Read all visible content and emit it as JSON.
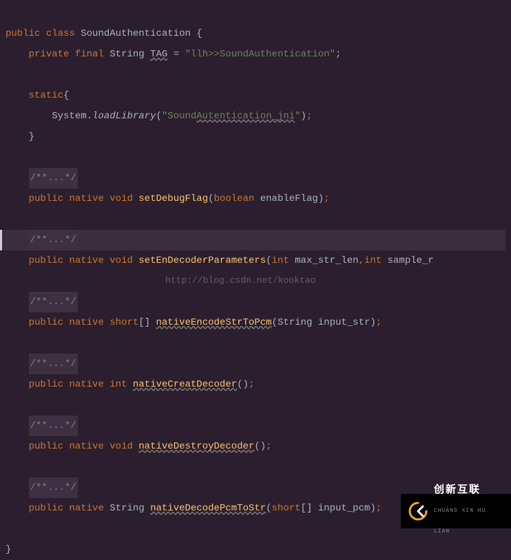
{
  "code": {
    "l1": {
      "kw1": "public",
      "kw2": "class",
      "cls": "SoundAuthentication",
      "brace": "{"
    },
    "l2": {
      "kw1": "private",
      "kw2": "final",
      "type": "String",
      "var": "TAG",
      "eq": "=",
      "str": "\"llh>>SoundAuthentication\"",
      "semi": ";"
    },
    "l3": {
      "kw": "static",
      "brace": "{"
    },
    "l4": {
      "cls": "System.",
      "method": "loadLibrary",
      "open": "(",
      "str": "\"Sound",
      "str2": "Autentication_jni",
      "str3": "\"",
      "close": ")",
      "semi": ";"
    },
    "l5": {
      "brace": "}"
    },
    "fold": "/**...*/",
    "l6": {
      "kw1": "public",
      "kw2": "native",
      "kw3": "void",
      "method": "setDebugFlag",
      "open": "(",
      "ptype": "boolean",
      "pname": "enableFlag",
      "close": ")",
      "semi": ";"
    },
    "l7": {
      "kw1": "public",
      "kw2": "native",
      "kw3": "void",
      "method": "setEnDecoderParameters",
      "open": "(",
      "ptype1": "int",
      "pname1": "max_str_len",
      "comma": ",",
      "ptype2": "int",
      "pname2": "sample_r"
    },
    "l8": {
      "kw1": "public",
      "kw2": "native",
      "kw3": "short",
      "arr": "[]",
      "method": "nativeEncodeStrToPcm",
      "open": "(",
      "ptype": "String",
      "pname": "input_str",
      "close": ")",
      "semi": ";"
    },
    "l9": {
      "kw1": "public",
      "kw2": "native",
      "kw3": "int",
      "method": "nativeCreatDecoder",
      "open": "(",
      "close": ")",
      "semi": ";"
    },
    "l10": {
      "kw1": "public",
      "kw2": "native",
      "kw3": "void",
      "method": "nativeDestroyDecoder",
      "open": "(",
      "close": ")",
      "semi": ";"
    },
    "l11": {
      "kw1": "public",
      "kw2": "native",
      "type": "String",
      "method": "nativeDecodePcmToStr",
      "open": "(",
      "ptype": "short",
      "arr": "[]",
      "pname": "input_pcm",
      "close": ")",
      "semi": ";"
    },
    "lend": {
      "brace": "}"
    }
  },
  "watermark": "http://blog.csdn.net/kooktao",
  "logo": {
    "main": "创新互联",
    "sub": "CHUANG XIN HU LIAN"
  }
}
